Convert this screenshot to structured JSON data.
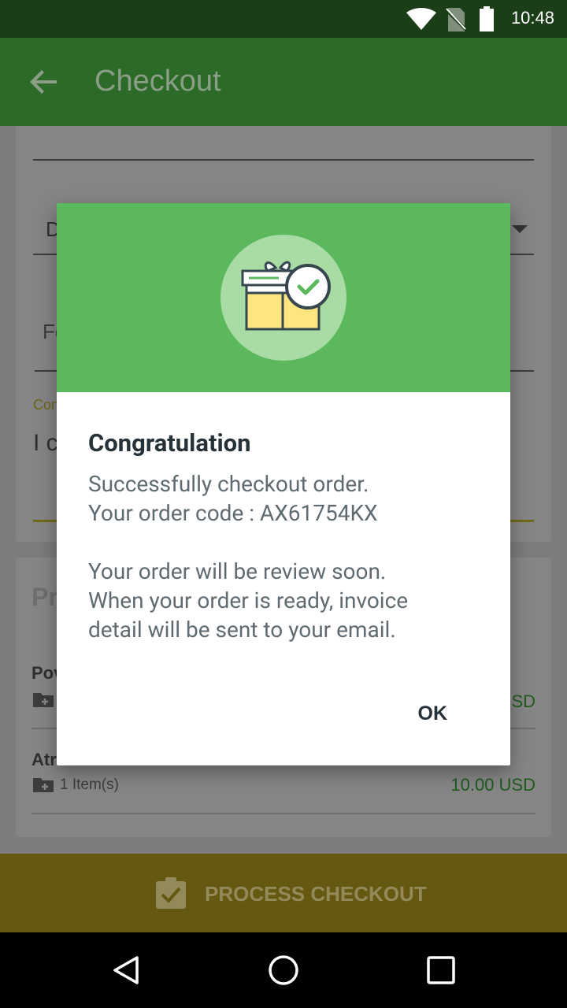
{
  "status_bar": {
    "time": "10:48"
  },
  "app_bar": {
    "title": "Checkout"
  },
  "background": {
    "partial_dropdown_text": "D",
    "partial_field_text": "Fo",
    "partial_label": "Con",
    "partial_comment": "I c",
    "products_header_partial": "Pr",
    "products": [
      {
        "name_partial": "Pov",
        "price_partial": "SD"
      },
      {
        "name_partial": "Atr",
        "count": "1 Item(s)",
        "price": "10.00 USD"
      }
    ]
  },
  "checkout_button": {
    "label": "PROCESS CHECKOUT"
  },
  "dialog": {
    "title": "Congratulation",
    "line1": "Successfully checkout order.",
    "line2": "Your order code : AX61754KX",
    "line3": "Your order will be review soon.",
    "line4": "When your order is ready, invoice",
    "line5": "detail will be sent to your email.",
    "ok_label": "OK"
  },
  "colors": {
    "primary_dark": "#1b3d18",
    "primary": "#2b6a27",
    "dialog_header": "#5cb85c",
    "accent_yellow": "#655811"
  }
}
